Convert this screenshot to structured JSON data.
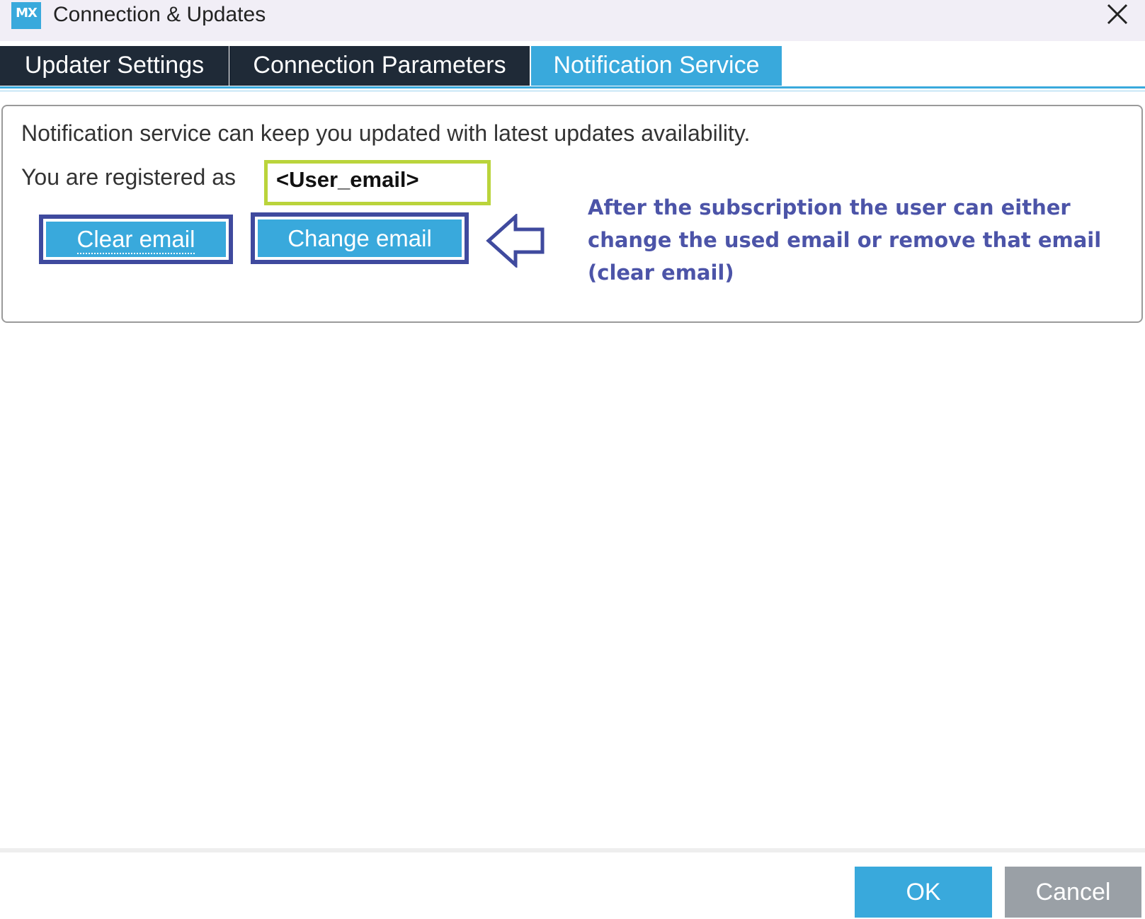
{
  "window": {
    "logo_text": "MX",
    "title": "Connection & Updates"
  },
  "tabs": [
    {
      "label": "Updater Settings",
      "active": false
    },
    {
      "label": "Connection Parameters",
      "active": false
    },
    {
      "label": "Notification Service",
      "active": true
    }
  ],
  "notification": {
    "description": "Notification service can keep you updated with latest updates availability.",
    "registered_label": "You are registered as",
    "email_value": "<User_email>",
    "clear_button": "Clear email",
    "change_button": "Change email"
  },
  "annotation": {
    "lines": [
      "After the subscription  the user can either",
      "change the used email or remove that email",
      "(clear email)"
    ]
  },
  "footer": {
    "ok_label": "OK",
    "cancel_label": "Cancel"
  },
  "colors": {
    "accent": "#39a9dc",
    "tab_inactive": "#1f2a37",
    "highlight_email": "#bad43b",
    "highlight_buttons": "#3f4a9e",
    "annotation_text": "#4c54a8",
    "cancel_button": "#9aa0a6"
  }
}
